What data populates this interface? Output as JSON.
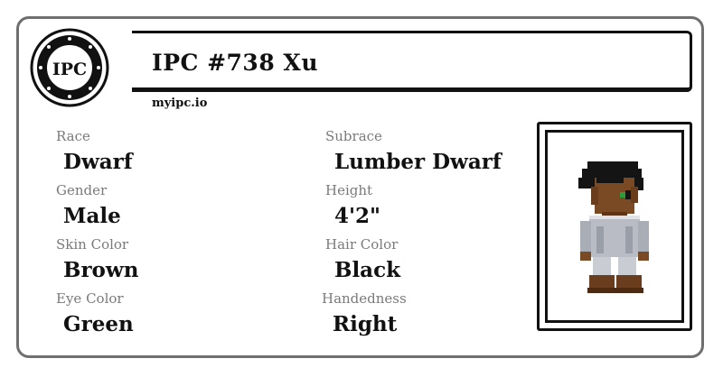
{
  "header": {
    "logo_text": "IPC",
    "title": "IPC #738 Xu",
    "site": "myipc.io"
  },
  "fields": {
    "race_label": "Race",
    "race_value": "Dwarf",
    "subrace_label": "Subrace",
    "subrace_value": "Lumber Dwarf",
    "gender_label": "Gender",
    "gender_value": "Male",
    "height_label": "Height",
    "height_value": "4'2\"",
    "skin_label": "Skin Color",
    "skin_value": "Brown",
    "hair_label": "Hair Color",
    "hair_value": "Black",
    "eye_label": "Eye Color",
    "eye_value": "Green",
    "hand_label": "Handedness",
    "hand_value": "Right"
  },
  "icons": {
    "logo": "ipc-emblem-icon",
    "portrait": "dwarf-character-portrait"
  },
  "colors": {
    "border": "#6f6f6f",
    "label": "#7a7a7a",
    "text": "#111111",
    "skin": "#7a4a24",
    "hair": "#141414",
    "eye": "#2f9a3a",
    "armor": "#b9bcc4"
  }
}
